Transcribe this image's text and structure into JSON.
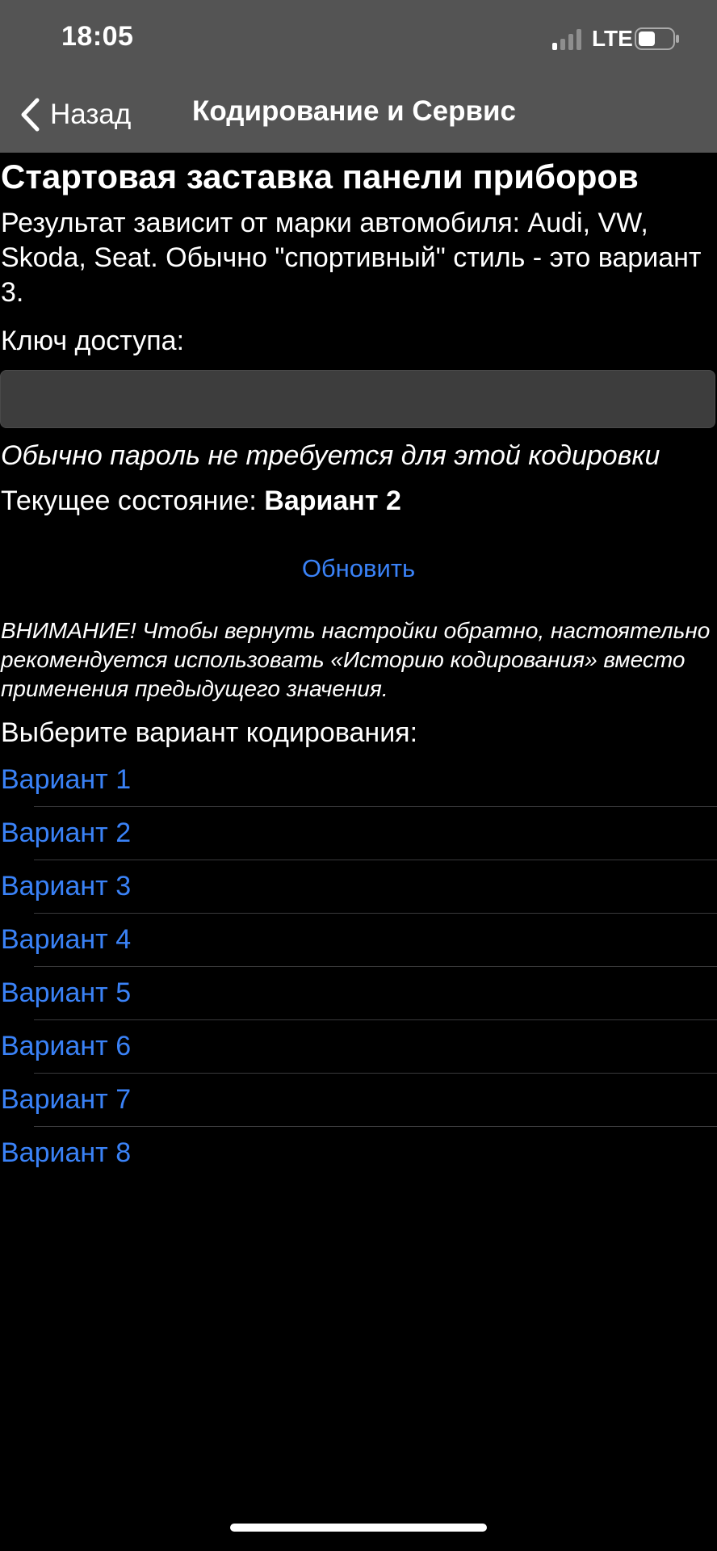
{
  "status_bar": {
    "time": "18:05",
    "network": "LTE",
    "signal_icon": "signal-bars-icon",
    "battery_icon": "battery-icon"
  },
  "nav": {
    "back_label": "Назад",
    "title": "Кодирование и Сервис"
  },
  "content": {
    "title": "Стартовая заставка панели приборов",
    "description": "Результат зависит от марки автомобиля: Audi, VW, Skoda, Seat. Обычно \"спортивный\" стиль - это вариант 3.",
    "key_label": "Ключ доступа:",
    "key_value": "",
    "hint": "Обычно пароль не требуется для этой кодировки",
    "state_label": "Текущее состояние: ",
    "state_value": "Вариант 2",
    "refresh_label": "Обновить",
    "warning": "ВНИМАНИЕ! Чтобы вернуть настройки обратно, настоятельно рекомендуется использовать «Историю кодирования» вместо применения предыдущего значения.",
    "choose_label": "Выберите вариант кодирования:",
    "options": [
      {
        "label": "Вариант 1"
      },
      {
        "label": "Вариант 2"
      },
      {
        "label": "Вариант 3"
      },
      {
        "label": "Вариант 4"
      },
      {
        "label": "Вариант 5"
      },
      {
        "label": "Вариант 6"
      },
      {
        "label": "Вариант 7"
      },
      {
        "label": "Вариант 8"
      }
    ]
  },
  "colors": {
    "accent": "#3a82f7",
    "background": "#000000",
    "topbar": "#545454"
  }
}
